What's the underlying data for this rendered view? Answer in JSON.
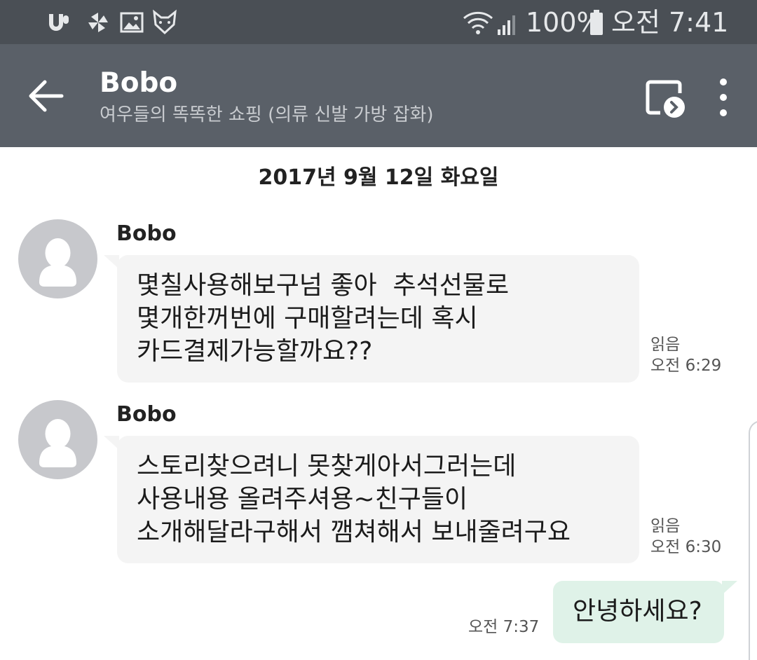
{
  "status_bar": {
    "battery_text": "100%",
    "time": "오전 7:41",
    "icons": [
      "unifi-app-icon",
      "pinwheel-icon",
      "gallery-icon",
      "fox-app-icon",
      "wifi-icon",
      "signal-icon",
      "battery-icon"
    ]
  },
  "header": {
    "title": "Bobo",
    "subtitle": "여우들의 똑똑한 쇼핑 (의류 신발 가방 잡화)",
    "back_icon": "arrow-left-icon",
    "cast_icon": "cast-screen-icon",
    "more_icon": "more-vert-icon"
  },
  "chat": {
    "date_separator": "2017년 9월 12일 화요일",
    "messages": [
      {
        "sender": "Bobo",
        "text": "몇칠사용해보구넘 좋아  추석선물로\n몇개한꺼번에 구매할려는데 혹시\n카드결제가능할까요??",
        "read_label": "읽음",
        "time": "오전 6:29"
      },
      {
        "sender": "Bobo",
        "text": "스토리찾으려니 못찾게아서그러는데\n사용내용 올려주셔용~친구들이\n소개해달라구해서 깸쳐해서 보내줄려구요",
        "read_label": "읽음",
        "time": "오전 6:30"
      },
      {
        "sender": "me",
        "text": "안녕하세요?",
        "time": "오전 7:37"
      }
    ]
  },
  "colors": {
    "status_bar": "#4a4f55",
    "app_bar": "#5a6068",
    "incoming_bubble": "#f4f4f4",
    "outgoing_bubble": "#dff2e8",
    "avatar": "#c7c8cc"
  }
}
